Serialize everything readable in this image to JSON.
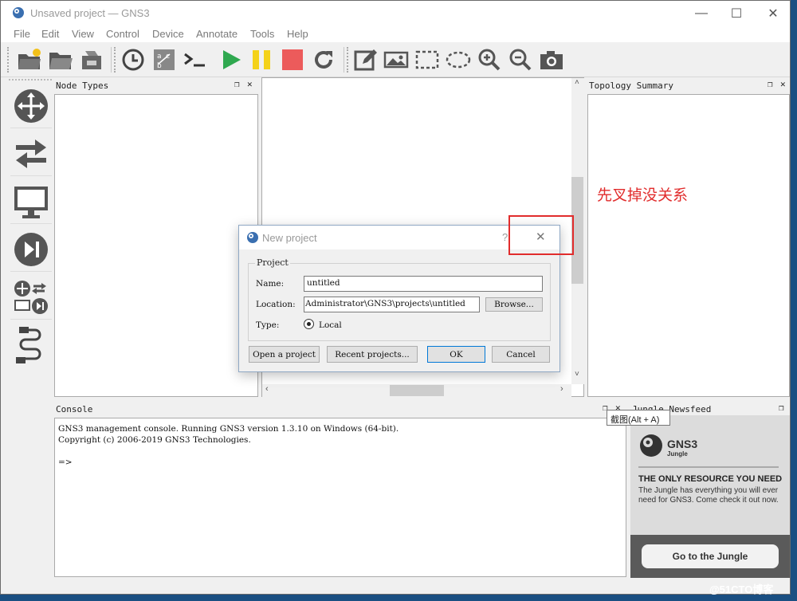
{
  "window": {
    "title": "Unsaved project — GNS3",
    "controls": {
      "minimize": "—",
      "maximize": "☐",
      "close": "✕"
    }
  },
  "menu": [
    "File",
    "Edit",
    "View",
    "Control",
    "Device",
    "Annotate",
    "Tools",
    "Help"
  ],
  "toolbar": {
    "icons": [
      "new-project-icon",
      "open-project-icon",
      "save-project-icon",
      "snapshot-clock-icon",
      "show-interface-labels-icon",
      "console-all-icon",
      "start-all-icon",
      "suspend-all-icon",
      "stop-all-icon",
      "reload-all-icon",
      "add-note-icon",
      "insert-picture-icon",
      "draw-rectangle-icon",
      "draw-ellipse-icon",
      "zoom-in-icon",
      "zoom-out-icon",
      "screenshot-icon"
    ],
    "colors": {
      "start": "#2fa84f",
      "suspend": "#f4d21a",
      "stop": "#ec5b5b"
    }
  },
  "device_dock": [
    "routers-icon",
    "switches-icon",
    "end-devices-icon",
    "security-devices-icon",
    "all-devices-icon",
    "add-link-icon"
  ],
  "panes": {
    "node_types": {
      "title": "Node Types"
    },
    "topology_summary": {
      "title": "Topology Summary"
    },
    "console": {
      "title": "Console",
      "lines": [
        "GNS3 management console. Running GNS3 version 1.3.10 on Windows (64-bit).",
        "Copyright (c) 2006-2019 GNS3 Technologies.",
        "",
        "=>"
      ]
    },
    "newsfeed": {
      "title": "Jungle Newsfeed",
      "logo_text": "GNS3",
      "logo_sub": "Jungle",
      "headline": "THE ONLY RESOURCE YOU NEED",
      "body": "The Jungle has everything you will ever need for GNS3. Come check it out now.",
      "button": "Go to the Jungle"
    }
  },
  "dialog": {
    "title": "New project",
    "help": "?",
    "close": "✕",
    "group_label": "Project",
    "name_label": "Name:",
    "name_value": "untitled",
    "location_label": "Location:",
    "location_value": "Administrator\\GNS3\\projects\\untitled",
    "browse_button": "Browse...",
    "type_label": "Type:",
    "type_option": "Local",
    "type_selected": true,
    "buttons": {
      "open": "Open a project",
      "recent": "Recent projects...",
      "ok": "OK",
      "cancel": "Cancel"
    }
  },
  "annotation": {
    "text": "先叉掉没关系",
    "color": "#e12c2c"
  },
  "tooltip": "截图(Alt + A)",
  "watermark": "@51CTO博客"
}
